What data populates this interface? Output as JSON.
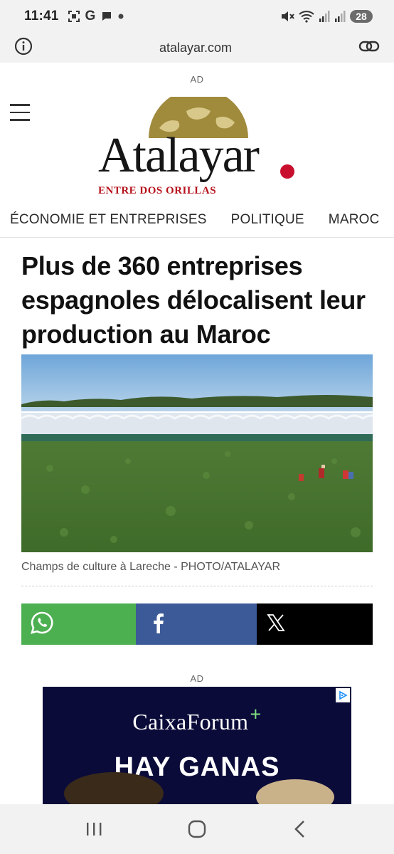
{
  "status_bar": {
    "time": "11:41",
    "battery": "28",
    "icons": [
      "screenshot-icon",
      "google-g-icon",
      "chat-bubble-icon",
      "dot-icon",
      "mute-icon",
      "wifi-icon",
      "signal-icon",
      "signal-icon-2",
      "battery-icon"
    ],
    "google_letter": "G"
  },
  "browser": {
    "url": "atalayar.com",
    "info_icon": "info-icon",
    "link_icon": "link-icon"
  },
  "page": {
    "ad_label_top": "AD",
    "logo": {
      "word": "Atalayar",
      "tagline": "ENTRE DOS ORILLAS",
      "brand_color": "#c8102e",
      "globe_color": "#a08a3c"
    },
    "nav": [
      "ÉCONOMIE ET ENTREPRISES",
      "POLITIQUE",
      "MAROC"
    ],
    "headline": "Plus de 360 entreprises espagnoles délocalisent leur production au Maroc",
    "photo_caption": "Champs de culture à Lareche - PHOTO/ATALAYAR",
    "share": {
      "whatsapp_color": "#4caf50",
      "facebook_color": "#3d5a98",
      "x_color": "#000000"
    },
    "ad_label_bottom": "AD",
    "ad": {
      "brand": "CaixaForum",
      "plus": "+",
      "slogan": "HAY GANAS"
    }
  },
  "system_nav": [
    "recents-icon",
    "home-icon",
    "back-icon"
  ]
}
